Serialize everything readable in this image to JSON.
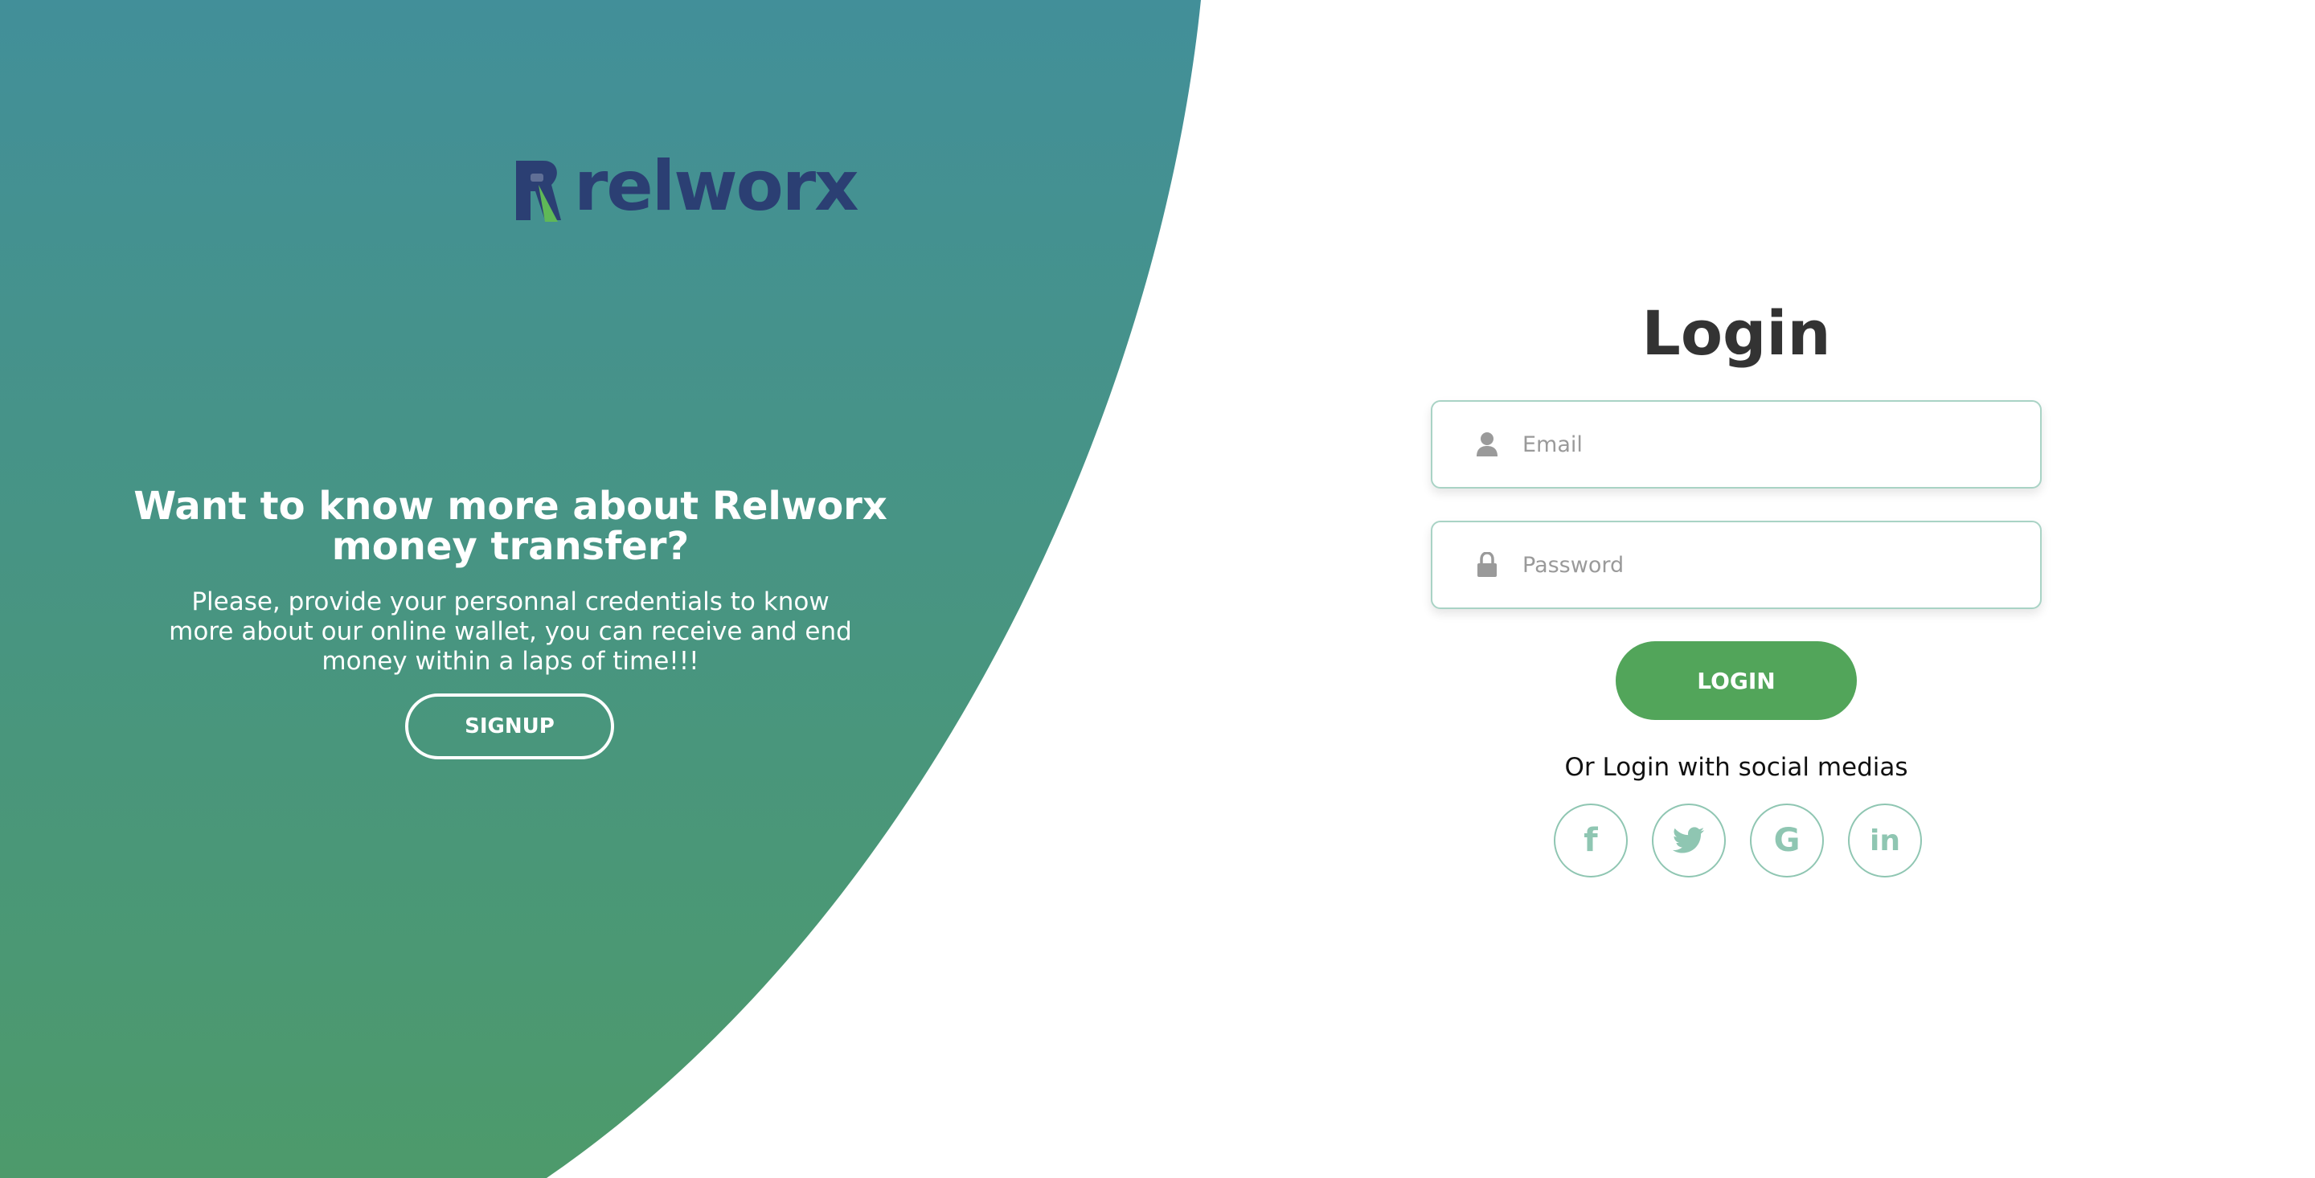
{
  "brand": {
    "name": "relworx",
    "colors": {
      "gradient_top": "#428f99",
      "gradient_bottom": "#4d9a6b",
      "logo_blue": "#2b3f73",
      "logo_green": "#5fb857",
      "accent_green": "#52a55a",
      "social_outline": "#8fc6b2"
    }
  },
  "promo": {
    "title": "Want to know more about Relworx money transfer?",
    "text": "Please, provide your personnal credentials to know more about our online wallet, you can receive and end money within a laps of time!!!",
    "signup_label": "SIGNUP"
  },
  "login": {
    "title": "Login",
    "email_placeholder": "Email",
    "password_placeholder": "Password",
    "button_label": "LOGIN",
    "social_text": "Or Login with social medias",
    "socials": [
      {
        "name": "facebook",
        "icon": "facebook-icon",
        "glyph": "f"
      },
      {
        "name": "twitter",
        "icon": "twitter-icon",
        "glyph": ""
      },
      {
        "name": "google",
        "icon": "google-icon",
        "glyph": "G"
      },
      {
        "name": "linkedin",
        "icon": "linkedin-icon",
        "glyph": "in"
      }
    ]
  }
}
